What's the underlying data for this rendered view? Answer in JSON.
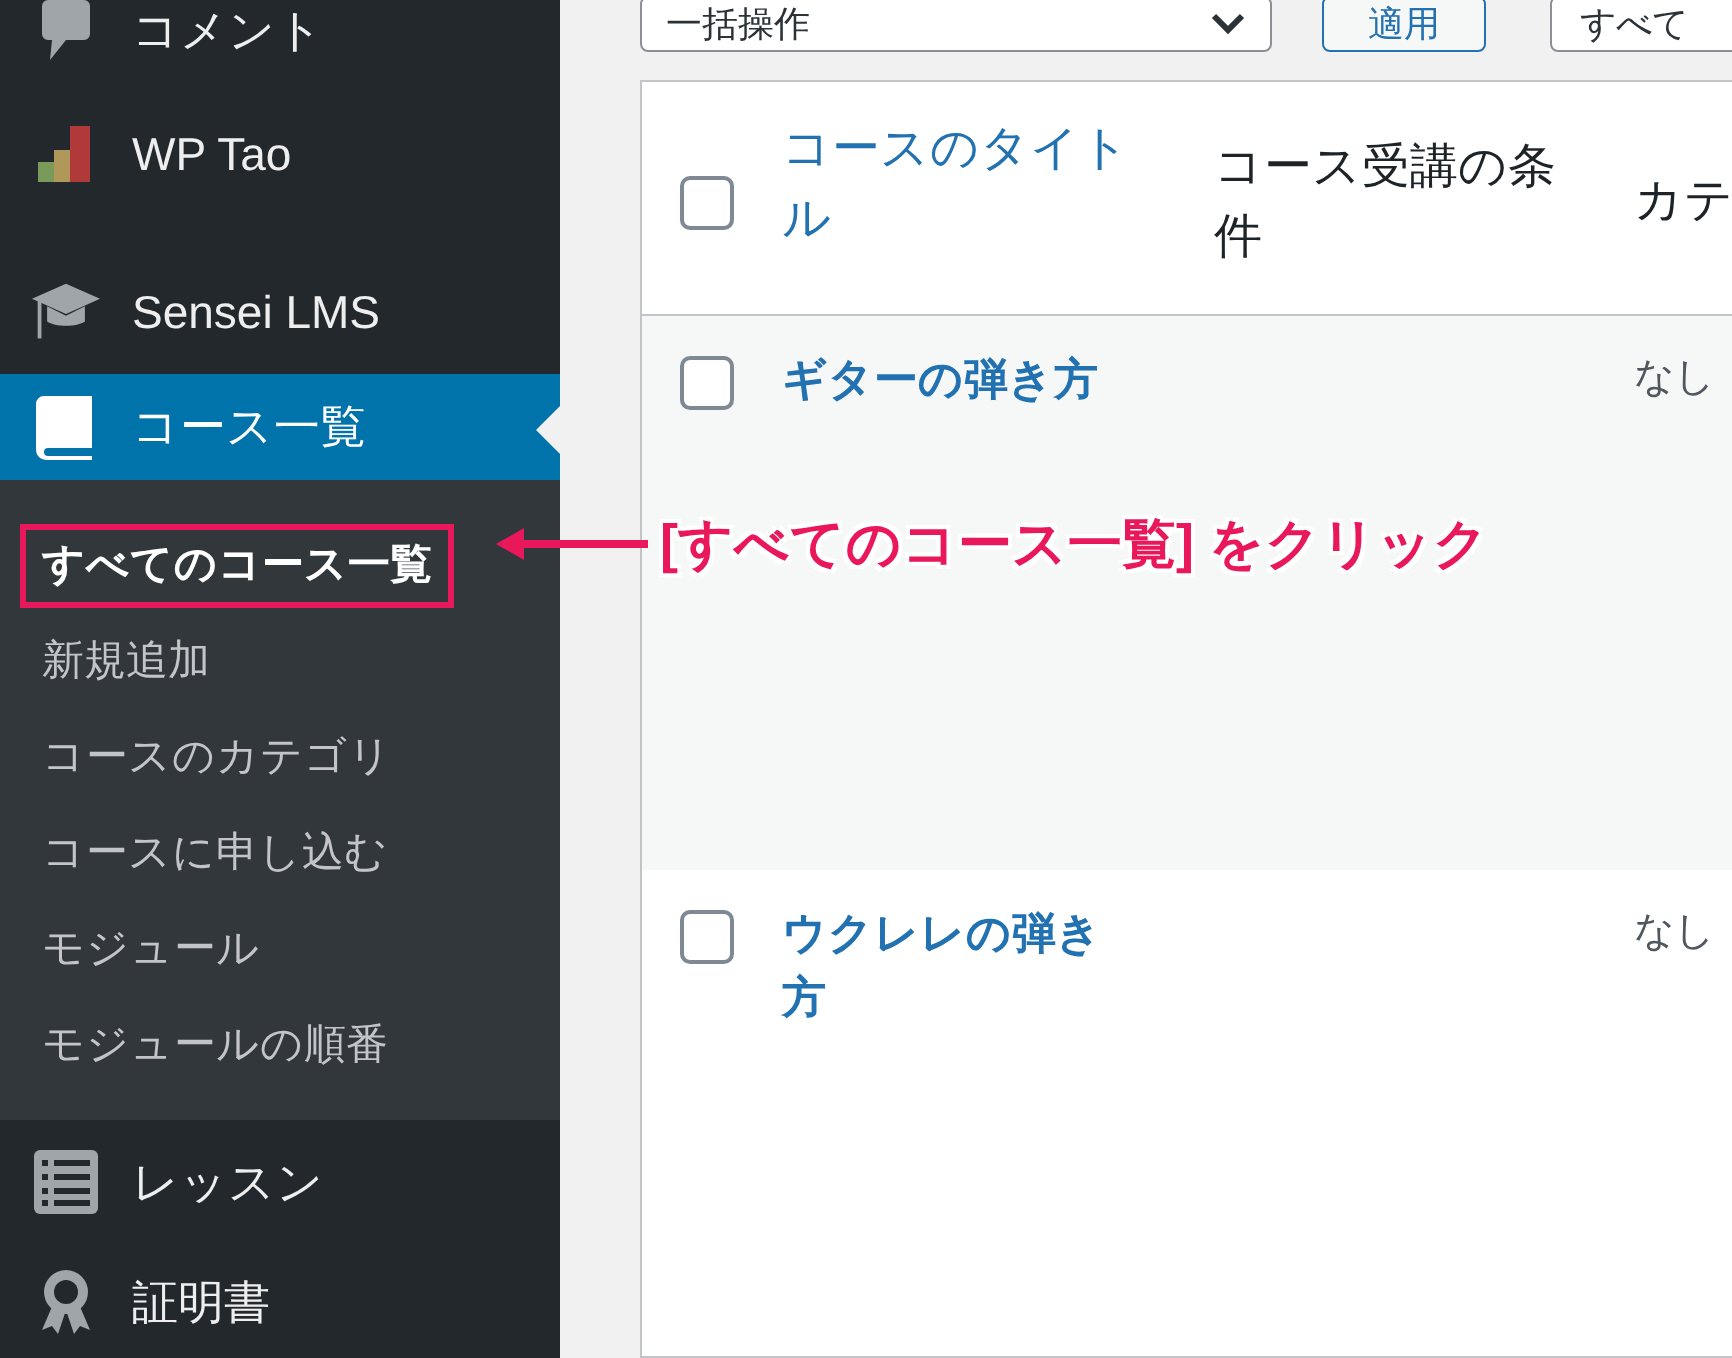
{
  "sidebar": {
    "items": [
      {
        "kind": "comment",
        "label": "コメント",
        "selected": false
      },
      {
        "kind": "chart",
        "label": "WP Tao",
        "selected": false
      },
      {
        "kind": "cap",
        "label": "Sensei LMS",
        "selected": false
      },
      {
        "kind": "book",
        "label": "コース一覧",
        "selected": true,
        "children": [
          {
            "label": "すべてのコース一覧",
            "selected": true
          },
          {
            "label": "新規追加",
            "selected": false
          },
          {
            "label": "コースのカテゴリ",
            "selected": false
          },
          {
            "label": "コースに申し込む",
            "selected": false
          },
          {
            "label": "モジュール",
            "selected": false
          },
          {
            "label": "モジュールの順番",
            "selected": false
          }
        ]
      },
      {
        "kind": "list",
        "label": "レッスン",
        "selected": false
      },
      {
        "kind": "award",
        "label": "証明書",
        "selected": false
      }
    ]
  },
  "toolbar": {
    "bulk_action": "一括操作",
    "apply": "適用",
    "filter": "すべて"
  },
  "table": {
    "columns": [
      "コースのタイトル",
      "コース受講の条件",
      "カテ"
    ],
    "select_all": {
      "checked": false
    },
    "rows": [
      {
        "title": "ギターの弾き方",
        "condition": "",
        "category": "なし",
        "checked": false
      },
      {
        "title": "ウクレレの弾き方",
        "condition": "",
        "category": "なし",
        "checked": false
      }
    ]
  },
  "annotation": {
    "text": "[すべてのコース一覧] をクリック"
  }
}
